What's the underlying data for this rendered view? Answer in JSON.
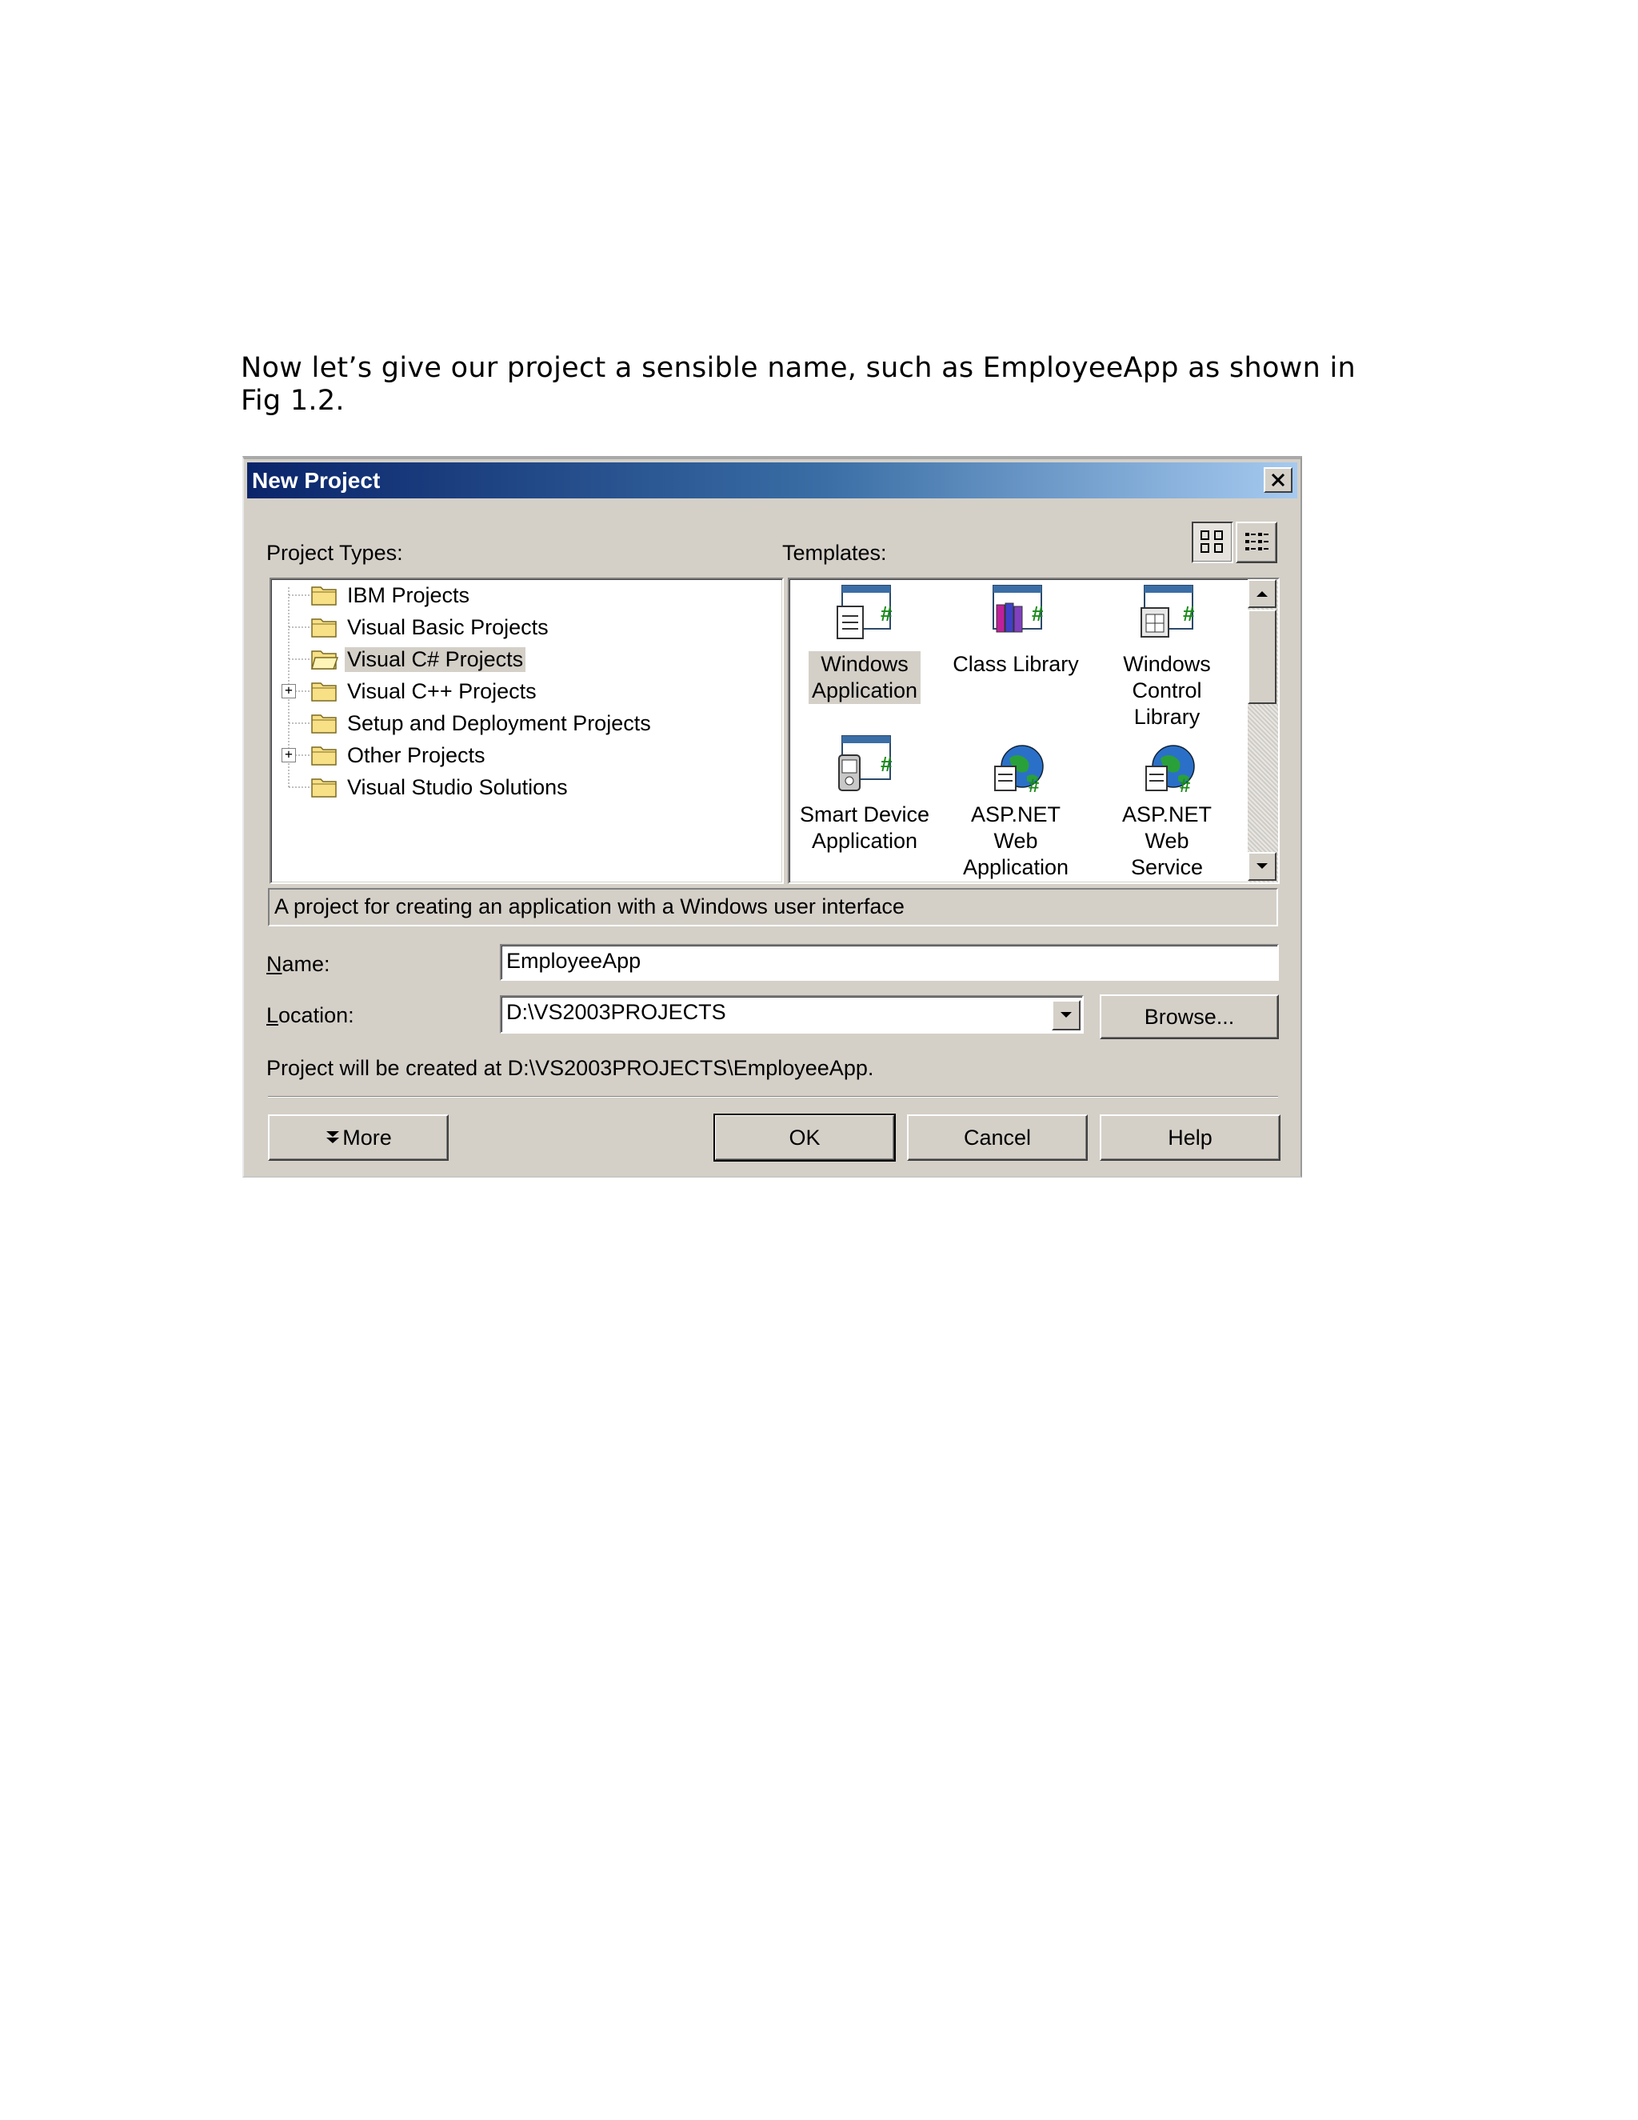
{
  "document": {
    "paragraph": "Now let’s give our project a sensible name, such as EmployeeApp as shown in Fig 1.2."
  },
  "dialog": {
    "title": "New Project",
    "project_types_label": "Project Types:",
    "templates_label": "Templates:",
    "project_types": [
      {
        "label": "IBM Projects",
        "expandable": false,
        "selected": false
      },
      {
        "label": "Visual Basic Projects",
        "expandable": false,
        "selected": false
      },
      {
        "label": "Visual C# Projects",
        "expandable": false,
        "selected": true
      },
      {
        "label": "Visual C++ Projects",
        "expandable": true,
        "selected": false
      },
      {
        "label": "Setup and Deployment Projects",
        "expandable": false,
        "selected": false
      },
      {
        "label": "Other Projects",
        "expandable": true,
        "selected": false
      },
      {
        "label": "Visual Studio Solutions",
        "expandable": false,
        "selected": false
      }
    ],
    "templates": [
      {
        "line1": "Windows",
        "line2": "Application",
        "icon": "windows-application-icon",
        "selected": true
      },
      {
        "line1": "Class Library",
        "line2": "",
        "icon": "class-library-icon",
        "selected": false
      },
      {
        "line1": "Windows",
        "line2": "Control Library",
        "icon": "windows-control-library-icon",
        "selected": false
      },
      {
        "line1": "Smart Device",
        "line2": "Application",
        "icon": "smart-device-application-icon",
        "selected": false
      },
      {
        "line1": "ASP.NET Web",
        "line2": "Application",
        "icon": "aspnet-web-application-icon",
        "selected": false
      },
      {
        "line1": "ASP.NET Web",
        "line2": "Service",
        "icon": "aspnet-web-service-icon",
        "selected": false
      }
    ],
    "description": "A project for creating an application with a Windows user interface",
    "name_label": "Name:",
    "name_value": "EmployeeApp",
    "location_label": "Location:",
    "location_value": "D:\\VS2003PROJECTS",
    "browse_label": "Browse...",
    "created_at": "Project will be created at D:\\VS2003PROJECTS\\EmployeeApp.",
    "more_label": "More",
    "ok_label": "OK",
    "cancel_label": "Cancel",
    "help_label": "Help"
  },
  "colors": {
    "dialog_face": "#d4d0c8",
    "title_start": "#0a246a",
    "title_end": "#a6caf0",
    "folder": "#f8e086"
  }
}
